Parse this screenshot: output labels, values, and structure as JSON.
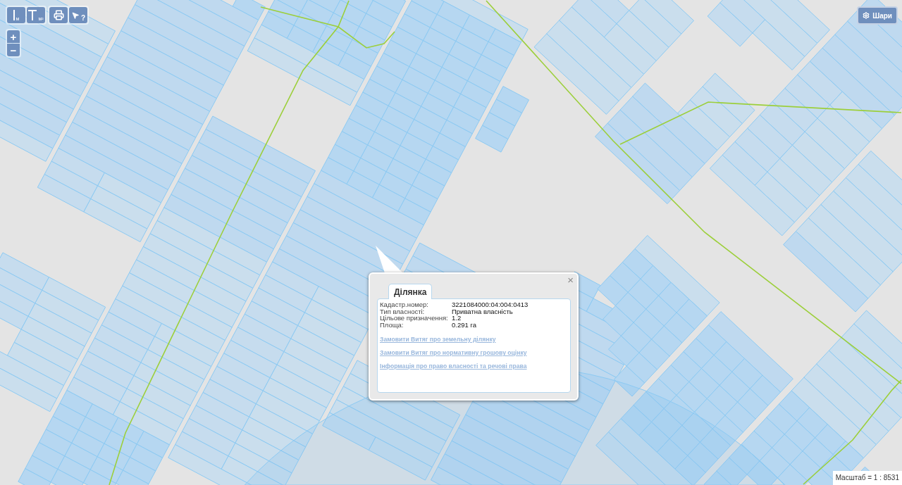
{
  "map_tools": [
    {
      "kind": "distance",
      "unit": "м"
    },
    {
      "kind": "area",
      "unit": "м²"
    },
    {
      "kind": "print"
    },
    {
      "kind": "identify",
      "mark": "?"
    }
  ],
  "zoom": [
    {
      "kind": "in",
      "label": "+"
    },
    {
      "kind": "out",
      "label": "−"
    }
  ],
  "layers_button": {
    "label": "Шари"
  },
  "popup": {
    "close": "×",
    "tabs": [
      {
        "label": "Ділянка",
        "selected": true
      }
    ],
    "fields": [
      {
        "label": "Кадастр.номер:",
        "value": "3221084000:04:004:0413"
      },
      {
        "label": "Тип власності:",
        "value": "Приватна власність"
      },
      {
        "label": "Цільове призначення:",
        "value": "1.2"
      },
      {
        "label": "Площа:",
        "value": "0.291 га"
      }
    ],
    "links": [
      "Замовити Витяг про земельну ділянку",
      "Замовити Витяг про нормативну грошову оцінку",
      "Інформація про право власності та речові права"
    ]
  },
  "scale": "Масштаб = 1 : 8531"
}
